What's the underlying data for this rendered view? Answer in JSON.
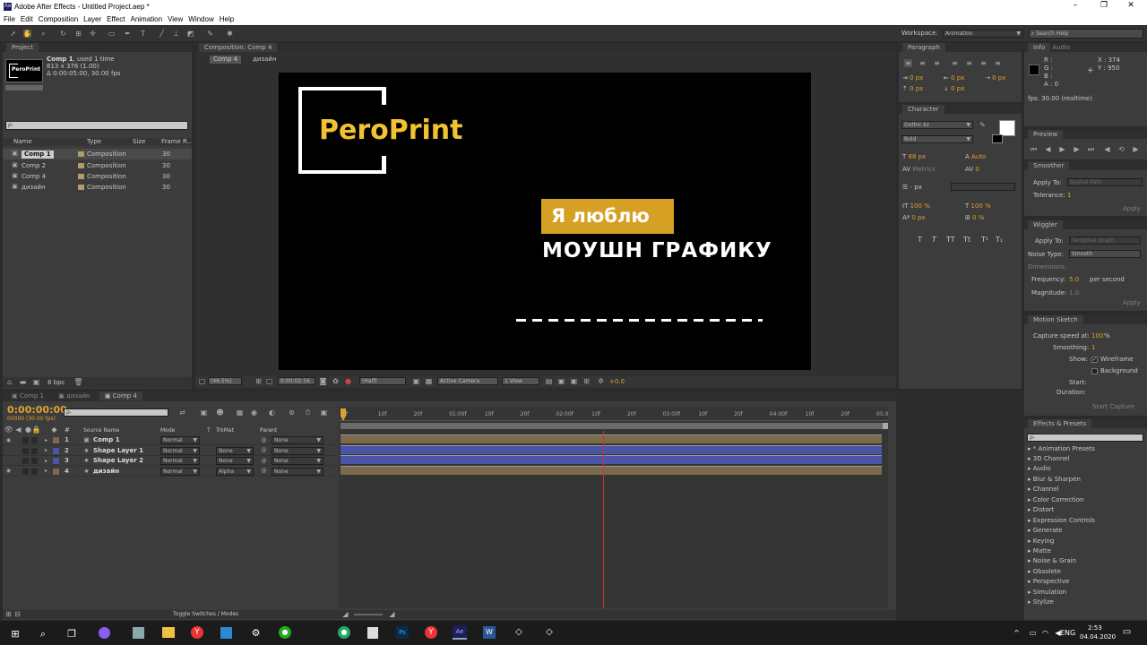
{
  "window": {
    "title": "Adobe After Effects - Untitled Project.aep *",
    "controls": [
      "–",
      "❐",
      "✕"
    ]
  },
  "menu": [
    "File",
    "Edit",
    "Composition",
    "Layer",
    "Effect",
    "Animation",
    "View",
    "Window",
    "Help"
  ],
  "toolbar": {
    "workspace_label": "Workspace:",
    "workspace_value": "Animation",
    "search_placeholder": "Search Help"
  },
  "project": {
    "tab": "Project",
    "thumb_label": "PeroPrint",
    "item_name": "Comp 1",
    "item_used": ", used 1 time",
    "item_dims": "613 x 376 (1.00)",
    "item_duration": "Δ 0:00:05:00, 30.00 fps",
    "search_placeholder": "ρ-",
    "columns": [
      "Name",
      "Type",
      "Size",
      "Frame R..."
    ],
    "items": [
      {
        "name": "Comp 1",
        "type": "Composition",
        "fr": "30"
      },
      {
        "name": "Comp 2",
        "type": "Composition",
        "fr": "30"
      },
      {
        "name": "Comp 4",
        "type": "Composition",
        "fr": "30"
      },
      {
        "name": "дизайн",
        "type": "Composition",
        "fr": "30"
      }
    ],
    "bpc": "8 bpc"
  },
  "comp": {
    "tab": "Composition: Comp 4",
    "crumbs": [
      "Comp 4",
      "дизайн"
    ],
    "logo_text": "PeroPrint",
    "badge_text": "Я люблю",
    "headline": "МОУШН ГРАФИКУ",
    "zoom": "(46.5%)",
    "timecode": "0:00:02:16",
    "resolution": "(Half)",
    "camera": "Active Camera",
    "view": "1 View",
    "exposure": "+0.0"
  },
  "paragraph": {
    "tab": "Paragraph",
    "values": [
      "0 px",
      "0 px",
      "0 px",
      "0 px",
      "0 px"
    ]
  },
  "character": {
    "tab": "Character",
    "font": "Gothic.kz",
    "style": "Bold",
    "size": "88 px",
    "leading": "Auto",
    "kerning": "Metrics",
    "tracking": "0",
    "stroke": "- px",
    "vscale": "100 %",
    "hscale": "100 %",
    "baseline": "0 px",
    "tsume": "0 %",
    "styles": [
      "T",
      "T",
      "TT",
      "Tt",
      "T¹",
      "T₁"
    ]
  },
  "info": {
    "tabs": [
      "Info",
      "Audio"
    ],
    "channels": [
      "R :",
      "G :",
      "B :",
      "A : 0"
    ],
    "x": "X : 374",
    "y": "Y : 950",
    "fps": "fps: 30.00 (realtime)"
  },
  "preview": {
    "tab": "Preview"
  },
  "smoother": {
    "tab": "Smoother",
    "apply_to_label": "Apply To:",
    "apply_to_value": "Spatial Path",
    "tolerance_label": "Tolerance:",
    "tolerance_value": "1",
    "apply": "Apply"
  },
  "wiggler": {
    "tab": "Wiggler",
    "apply_to_label": "Apply To:",
    "apply_to_value": "Temporal Graph",
    "noise_label": "Noise Type:",
    "noise_value": "Smooth",
    "dimensions_label": "Dimensions:",
    "frequency_label": "Frequency:",
    "frequency_value": "5.0",
    "frequency_unit": "per second",
    "magnitude_label": "Magnitude:",
    "magnitude_value": "1.0",
    "apply": "Apply"
  },
  "motion_sketch": {
    "tab": "Motion Sketch",
    "capture_label": "Capture speed at:",
    "capture_value": "100",
    "capture_unit": "%",
    "smoothing_label": "Smoothing:",
    "smoothing_value": "1",
    "show_label": "Show:",
    "wireframe": "Wireframe",
    "background": "Background",
    "start_label": "Start:",
    "duration_label": "Duration:",
    "start_capture": "Start Capture"
  },
  "effects": {
    "tab": "Effects & Presets",
    "search_placeholder": "ρ-",
    "items": [
      "* Animation Presets",
      "3D Channel",
      "Audio",
      "Blur & Sharpen",
      "Channel",
      "Color Correction",
      "Distort",
      "Expression Controls",
      "Generate",
      "Keying",
      "Matte",
      "Noise & Grain",
      "Obsolete",
      "Perspective",
      "Simulation",
      "Stylize"
    ]
  },
  "timeline": {
    "tabs": [
      "Comp 1",
      "дизайн",
      "Comp 4"
    ],
    "timecode": "0:00:00:00",
    "fps": "00000 (30.00 fps)",
    "search_placeholder": "ρ-",
    "columns": {
      "num": "#",
      "source": "Source Name",
      "mode": "Mode",
      "t": "T",
      "trkmat": "TrkMat",
      "parent": "Parent"
    },
    "layers": [
      {
        "num": "1",
        "name": "Comp 1",
        "mode": "Normal",
        "trkmat": "",
        "parent": "None",
        "color": "#7d6a4d"
      },
      {
        "num": "2",
        "name": "Shape Layer 1",
        "mode": "Normal",
        "trkmat": "None",
        "parent": "None",
        "color": "#4a55a8"
      },
      {
        "num": "3",
        "name": "Shape Layer 2",
        "mode": "Normal",
        "trkmat": "None",
        "parent": "None",
        "color": "#4a55a8"
      },
      {
        "num": "4",
        "name": "дизайн",
        "mode": "Normal",
        "trkmat": "Alpha",
        "parent": "None",
        "color": "#7d6a4d"
      }
    ],
    "ruler": [
      "0f",
      "10f",
      "20f",
      "01:00f",
      "10f",
      "20f",
      "02:00f",
      "10f",
      "20f",
      "03:00f",
      "10f",
      "20f",
      "04:00f",
      "10f",
      "20f",
      "05:0"
    ],
    "toggle_label": "Toggle Switches / Modes"
  },
  "taskbar": {
    "lang": "ENG",
    "time": "2:53",
    "date": "04.04.2020"
  }
}
